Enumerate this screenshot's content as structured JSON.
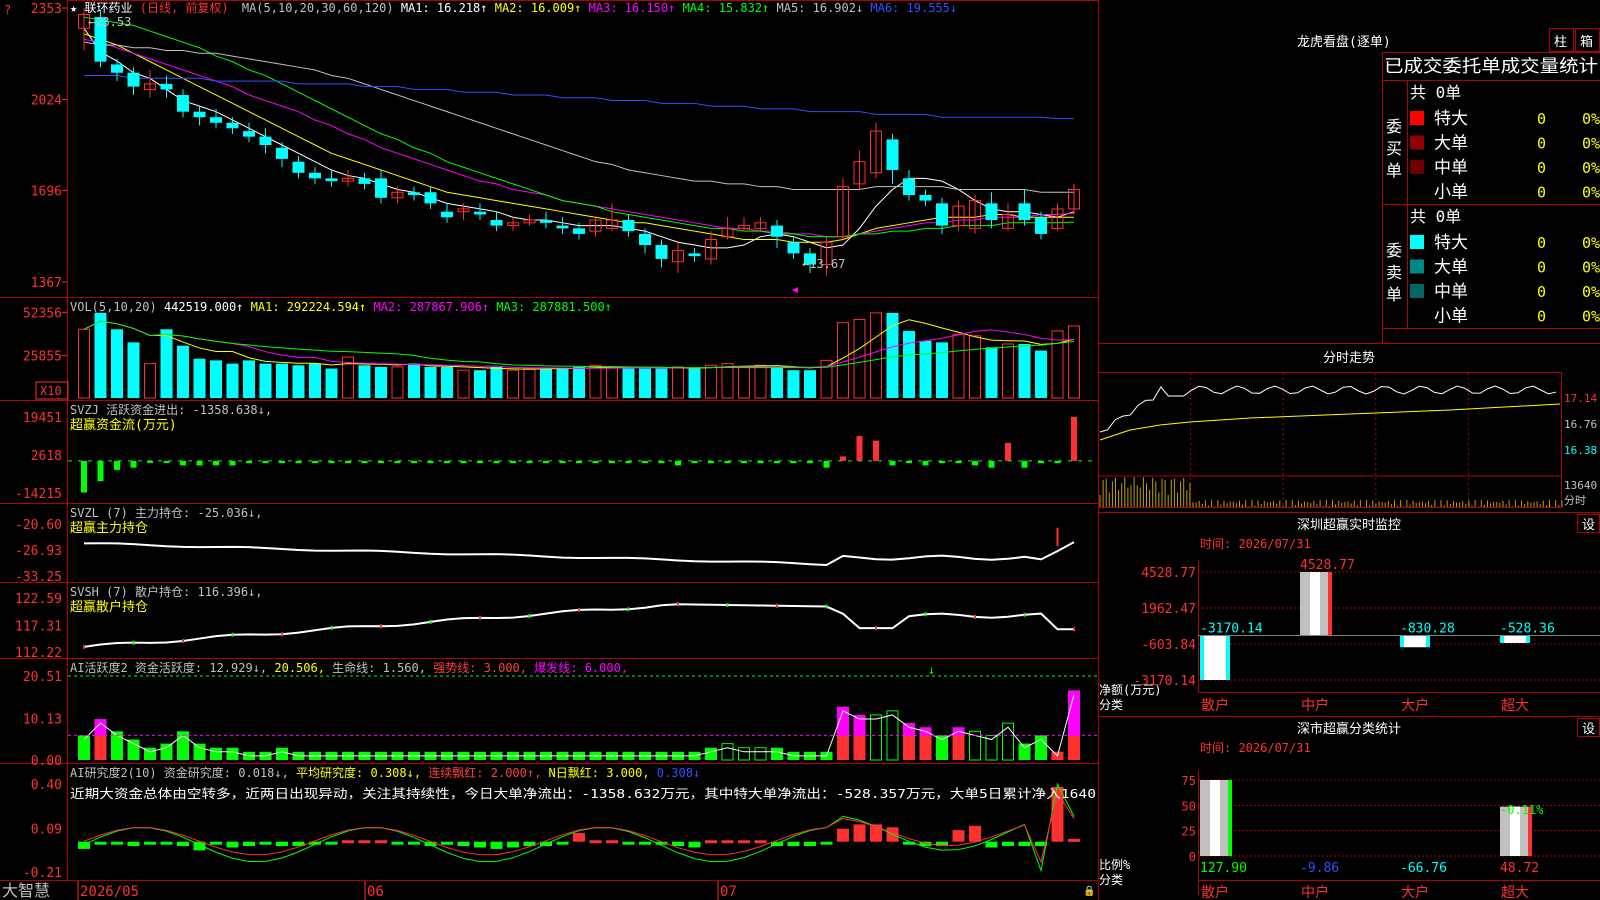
{
  "app": {
    "brand": "大智慧"
  },
  "stock": {
    "name": "联环药业",
    "period": "(日线, 前复权)"
  },
  "colors": {
    "up": "#ff3030",
    "down": "#00ffff",
    "bg": "#000000",
    "grid": "#b00000",
    "ma1": "#ffffff",
    "ma2": "#ffff00",
    "ma3": "#ff00ff",
    "ma4": "#00ff00",
    "ma5": "#c0c0c0",
    "ma6": "#3050ff"
  },
  "price_panel": {
    "header_prefix": "MA(5,10,20,30,60,120)",
    "ma_labels": [
      {
        "text": "MA1: 16.218",
        "arrow": "↑"
      },
      {
        "text": "MA2: 16.009",
        "arrow": "↑"
      },
      {
        "text": "MA3: 16.150",
        "arrow": "↑"
      },
      {
        "text": "MA4: 15.832",
        "arrow": "↑"
      },
      {
        "text": "MA5: 16.902",
        "arrow": "↓"
      },
      {
        "text": "MA6: 19.555",
        "arrow": "↓"
      }
    ],
    "ticks": [
      "2353",
      "2024",
      "1696",
      "1367"
    ],
    "high_label": "23.53",
    "low_label": "13.67"
  },
  "vol_panel": {
    "header": "VOL(5,10,20)",
    "items": [
      {
        "text": "442519.000",
        "arrow": "↑"
      },
      {
        "text": "MA1: 292224.594",
        "arrow": "↑"
      },
      {
        "text": "MA2: 287867.906",
        "arrow": "↑"
      },
      {
        "text": "MA3: 287881.500",
        "arrow": "↑"
      }
    ],
    "ticks": [
      "52356",
      "25855"
    ],
    "scale": "X10"
  },
  "svzj_panel": {
    "line1": "SVZJ  活跃资金进出: -1358.638↓,",
    "line2": "超赢资金流(万元)",
    "ticks": [
      "19451",
      "2618",
      "-14215"
    ]
  },
  "svzl_panel": {
    "line1": "SVZL  (7) 主力持仓: -25.036↓,",
    "line2": "超赢主力持仓",
    "ticks": [
      "-20.60",
      "-26.93",
      "-33.25"
    ]
  },
  "svsh_panel": {
    "line1": "SVSH  (7) 散户持仓: 116.396↓,",
    "line2": "超赢散户持仓",
    "ticks": [
      "122.59",
      "117.31",
      "112.22"
    ]
  },
  "ai_active_panel": {
    "parts": [
      {
        "text": "AI活跃度2 资金活跃度: 12.929↓,",
        "color": "#c0c0c0"
      },
      {
        "text": " 20.506,",
        "color": "#ffff00"
      },
      {
        "text": " 生命线: 1.560,",
        "color": "#c0c0c0"
      },
      {
        "text": " 强势线: 3.000,",
        "color": "#ff4040"
      },
      {
        "text": " 爆发线: 6.000,",
        "color": "#ff00ff"
      }
    ],
    "ticks": [
      "20.51",
      "10.13",
      "0.00"
    ]
  },
  "ai_research_panel": {
    "parts": [
      {
        "text": "AI研究度2(10) 资金研究度: 0.018↓,",
        "color": "#c0c0c0"
      },
      {
        "text": " 平均研究度: 0.308↓,",
        "color": "#ffff00"
      },
      {
        "text": " 连续飘红: 2.000↑,",
        "color": "#ff4040"
      },
      {
        "text": " N日飘红: 3.000,",
        "color": "#ffff00"
      },
      {
        "text": " 0.308↓",
        "color": "#3050ff"
      }
    ],
    "comment": "近期大资金总体由空转多，近两日出现异动，关注其持续性，今日大单净流出：-1358.632万元，其中特大单净流出：-528.357万元，大单5日累计净入1640",
    "ticks": [
      "0.40",
      "0.09",
      "-0.21"
    ]
  },
  "x_axis": {
    "labels": [
      "2026/05",
      "06",
      "07"
    ]
  },
  "longhu": {
    "title": "龙虎看盘(逐单)",
    "tabs": [
      "柱",
      "箱"
    ],
    "table_title": "已成交委托单成交量统计",
    "buy": {
      "label_chars": [
        "委",
        "买",
        "单"
      ],
      "total": "共 0单",
      "rows": [
        {
          "name": "特大",
          "count": "0",
          "pct": "0%"
        },
        {
          "name": "大单",
          "count": "0",
          "pct": "0%"
        },
        {
          "name": "中单",
          "count": "0",
          "pct": "0%"
        },
        {
          "name": "小单",
          "count": "0",
          "pct": "0%"
        }
      ]
    },
    "sell": {
      "label_chars": [
        "委",
        "卖",
        "单"
      ],
      "total": "共 0单",
      "rows": [
        {
          "name": "特大",
          "count": "0",
          "pct": "0%"
        },
        {
          "name": "大单",
          "count": "0",
          "pct": "0%"
        },
        {
          "name": "中单",
          "count": "0",
          "pct": "0%"
        },
        {
          "name": "小单",
          "count": "0",
          "pct": "0%"
        }
      ]
    }
  },
  "fenshi": {
    "title": "分时走势",
    "ticks": [
      "17.14",
      "16.76",
      "16.38"
    ],
    "vol_tick": "13640",
    "unit": "分时"
  },
  "monitor": {
    "title": "深圳超赢实时监控",
    "setting": "设",
    "time": "时间: 2026/07/31",
    "y_ticks": [
      "4528.77",
      "1962.47",
      "-603.84",
      "-3170.14"
    ],
    "ylabel1": "净额(万元)",
    "ylabel2": "分类",
    "categories": [
      "散户",
      "中户",
      "大户",
      "超大"
    ]
  },
  "classify": {
    "title": "深市超赢分类统计",
    "setting": "设",
    "time": "时间: 2026/07/31",
    "y_ticks": [
      "75",
      "50",
      "25",
      "0"
    ],
    "ylabel1": "比例%",
    "ylabel2": "分类",
    "categories": [
      "散户",
      "中户",
      "大户",
      "超大"
    ],
    "bottom_values": [
      "127.90",
      "-9.86",
      "-66.76",
      "48.72"
    ],
    "top_label": "-0.11%"
  },
  "chart_data": [
    {
      "type": "bar",
      "title": "深圳超赢实时监控",
      "categories": [
        "散户",
        "中户",
        "大户",
        "超大"
      ],
      "values": [
        -3170.14,
        4528.77,
        -830.28,
        -528.36
      ],
      "ylabel": "净额(万元)",
      "ylim": [
        -3170.14,
        4528.77
      ]
    },
    {
      "type": "bar",
      "title": "深市超赢分类统计",
      "categories": [
        "散户",
        "中户",
        "大户",
        "超大"
      ],
      "values": [
        127.9,
        -9.86,
        -66.76,
        48.72
      ],
      "ylabel": "比例%",
      "ylim": [
        0,
        75
      ]
    },
    {
      "type": "candlestick",
      "x": [
        "2026/05",
        "06",
        "07"
      ],
      "ylim": [
        13.67,
        23.53
      ],
      "candles": [
        [
          22.8,
          23.3,
          23.53,
          22.0
        ],
        [
          23.2,
          21.6,
          23.45,
          21.4
        ],
        [
          21.5,
          21.2,
          21.7,
          20.9
        ],
        [
          21.2,
          20.7,
          21.4,
          20.4
        ],
        [
          20.6,
          20.8,
          21.3,
          20.3
        ],
        [
          20.8,
          20.6,
          21.1,
          20.3
        ],
        [
          20.4,
          19.8,
          20.6,
          19.6
        ],
        [
          19.8,
          19.6,
          20.0,
          19.3
        ],
        [
          19.6,
          19.4,
          19.9,
          19.2
        ],
        [
          19.4,
          19.2,
          19.6,
          19.0
        ],
        [
          19.1,
          18.9,
          19.4,
          18.7
        ],
        [
          18.9,
          18.6,
          19.2,
          18.3
        ],
        [
          18.5,
          18.1,
          18.7,
          17.8
        ],
        [
          18.0,
          17.6,
          18.2,
          17.4
        ],
        [
          17.6,
          17.4,
          17.8,
          17.2
        ],
        [
          17.4,
          17.3,
          17.7,
          17.1
        ],
        [
          17.3,
          17.4,
          17.7,
          17.1
        ],
        [
          17.4,
          17.2,
          17.6,
          17.0
        ],
        [
          17.4,
          16.7,
          17.7,
          16.5
        ],
        [
          16.7,
          16.9,
          17.1,
          16.5
        ],
        [
          16.9,
          16.8,
          17.1,
          16.6
        ],
        [
          16.9,
          16.5,
          17.1,
          16.3
        ],
        [
          16.2,
          16.0,
          16.5,
          15.8
        ],
        [
          16.2,
          16.3,
          16.5,
          15.9
        ],
        [
          16.2,
          16.1,
          16.5,
          15.9
        ],
        [
          15.9,
          15.7,
          16.2,
          15.5
        ],
        [
          15.7,
          15.8,
          16.0,
          15.5
        ],
        [
          15.8,
          15.9,
          16.1,
          15.7
        ],
        [
          15.9,
          15.8,
          16.2,
          15.6
        ],
        [
          15.7,
          15.6,
          16.0,
          15.4
        ],
        [
          15.6,
          15.4,
          15.8,
          15.2
        ],
        [
          15.5,
          15.9,
          16.0,
          15.3
        ],
        [
          15.6,
          15.9,
          16.5,
          15.5
        ],
        [
          15.9,
          15.5,
          16.1,
          15.3
        ],
        [
          15.4,
          15.0,
          15.6,
          14.7
        ],
        [
          15.0,
          14.5,
          15.2,
          14.2
        ],
        [
          14.4,
          14.8,
          15.1,
          14.0
        ],
        [
          14.7,
          14.6,
          14.9,
          14.4
        ],
        [
          14.5,
          15.2,
          15.5,
          14.3
        ],
        [
          15.3,
          15.6,
          16.0,
          15.2
        ],
        [
          15.6,
          15.7,
          16.0,
          15.5
        ],
        [
          15.6,
          15.8,
          16.0,
          15.5
        ],
        [
          15.7,
          15.3,
          15.9,
          14.9
        ],
        [
          15.1,
          14.7,
          15.3,
          14.5
        ],
        [
          14.7,
          14.3,
          14.9,
          14.0
        ],
        [
          14.3,
          15.1,
          15.3,
          13.9
        ],
        [
          15.3,
          17.1,
          17.4,
          15.2
        ],
        [
          17.2,
          18.0,
          18.4,
          17.0
        ],
        [
          17.6,
          19.1,
          19.4,
          17.4
        ],
        [
          18.8,
          17.7,
          19.0,
          17.2
        ],
        [
          17.4,
          16.8,
          17.7,
          16.6
        ],
        [
          16.8,
          16.6,
          17.0,
          16.4
        ],
        [
          16.5,
          15.7,
          16.7,
          15.4
        ],
        [
          15.7,
          16.4,
          16.6,
          15.5
        ],
        [
          15.6,
          16.6,
          16.8,
          15.4
        ],
        [
          16.5,
          15.9,
          16.9,
          15.6
        ],
        [
          15.6,
          16.1,
          16.5,
          15.5
        ],
        [
          16.5,
          15.9,
          17.0,
          15.7
        ],
        [
          16.0,
          15.4,
          16.2,
          15.2
        ],
        [
          15.6,
          16.3,
          16.5,
          15.5
        ],
        [
          16.3,
          17.0,
          17.2,
          16.1
        ]
      ],
      "volume": [
        42,
        52,
        42,
        34,
        21,
        42,
        32,
        24,
        23,
        21,
        23,
        21,
        21,
        20,
        21,
        18,
        25,
        20,
        19,
        19,
        21,
        19,
        19,
        17,
        17,
        19,
        17,
        18,
        18,
        18,
        19,
        20,
        19,
        18,
        18,
        18,
        19,
        18,
        20,
        21,
        19,
        20,
        19,
        17,
        17,
        23,
        46,
        48,
        52,
        52,
        41,
        35,
        34,
        39,
        38,
        31,
        33,
        33,
        29,
        41,
        44
      ],
      "ma_series": [
        {
          "name": "MA1",
          "values": [
            22.8,
            21.95,
            21.62,
            21.2,
            21.0,
            20.6,
            20.2,
            20.0,
            19.8,
            19.5,
            19.2,
            18.9,
            18.6,
            18.3,
            18.0,
            17.7,
            17.5,
            17.4,
            17.2,
            17.0,
            16.9,
            16.7,
            16.5,
            16.4,
            16.3,
            16.2,
            16.0,
            15.9,
            15.9,
            15.8,
            15.7,
            15.7,
            15.7,
            15.6,
            15.5,
            15.3,
            15.1,
            15.0,
            14.9,
            14.9,
            15.0,
            15.3,
            15.4,
            15.3,
            15.1,
            14.9,
            15.0,
            15.6,
            16.4,
            17.0,
            17.4,
            17.4,
            17.3,
            17.0,
            16.6,
            16.3,
            16.2,
            16.2,
            16.1,
            16.0,
            16.2
          ]
        },
        {
          "name": "MA2",
          "values": [
            22.6,
            22.4,
            22.2,
            21.9,
            21.6,
            21.3,
            21.0,
            20.7,
            20.4,
            20.1,
            19.8,
            19.5,
            19.2,
            18.9,
            18.6,
            18.3,
            18.1,
            17.9,
            17.7,
            17.5,
            17.3,
            17.1,
            16.9,
            16.8,
            16.7,
            16.6,
            16.5,
            16.4,
            16.3,
            16.2,
            16.1,
            16.0,
            15.9,
            15.8,
            15.8,
            15.7,
            15.6,
            15.5,
            15.4,
            15.3,
            15.2,
            15.2,
            15.2,
            15.1,
            15.1,
            15.1,
            15.2,
            15.4,
            15.6,
            15.7,
            15.8,
            15.9,
            16.0,
            16.0,
            16.0,
            16.1,
            16.1,
            16.0,
            16.0,
            16.0,
            16.0
          ]
        },
        {
          "name": "MA3",
          "values": [
            22.4,
            22.3,
            22.1,
            21.9,
            21.7,
            21.5,
            21.3,
            21.1,
            20.9,
            20.7,
            20.4,
            20.2,
            20.0,
            19.8,
            19.5,
            19.3,
            19.0,
            18.8,
            18.5,
            18.3,
            18.1,
            17.9,
            17.7,
            17.5,
            17.3,
            17.2,
            17.0,
            16.9,
            16.8,
            16.6,
            16.5,
            16.4,
            16.3,
            16.2,
            16.1,
            16.0,
            15.9,
            15.8,
            15.7,
            15.6,
            15.6,
            15.5,
            15.5,
            15.4,
            15.4,
            15.3,
            15.3,
            15.4,
            15.5,
            15.6,
            15.7,
            15.8,
            15.8,
            15.9,
            15.9,
            16.0,
            16.0,
            16.0,
            16.1,
            16.1,
            16.15
          ]
        },
        {
          "name": "MA4",
          "values": [
            23.2,
            23.1,
            23.0,
            22.9,
            22.7,
            22.5,
            22.3,
            22.1,
            21.8,
            21.6,
            21.3,
            21.1,
            20.8,
            20.5,
            20.2,
            19.9,
            19.6,
            19.3,
            19.0,
            18.8,
            18.5,
            18.3,
            18.0,
            17.8,
            17.6,
            17.4,
            17.2,
            17.0,
            16.8,
            16.6,
            16.5,
            16.4,
            16.2,
            16.1,
            16.0,
            15.9,
            15.8,
            15.7,
            15.6,
            15.6,
            15.5,
            15.5,
            15.4,
            15.4,
            15.3,
            15.3,
            15.3,
            15.4,
            15.4,
            15.5,
            15.5,
            15.6,
            15.6,
            15.7,
            15.7,
            15.7,
            15.8,
            15.8,
            15.8,
            15.8,
            15.83
          ]
        },
        {
          "name": "MA5",
          "values": [
            22.3,
            22.2,
            22.2,
            22.1,
            22.1,
            22.0,
            22.0,
            21.9,
            21.9,
            21.8,
            21.7,
            21.6,
            21.5,
            21.4,
            21.3,
            21.1,
            21.0,
            20.8,
            20.6,
            20.4,
            20.2,
            20.0,
            19.8,
            19.6,
            19.4,
            19.2,
            19.0,
            18.8,
            18.6,
            18.4,
            18.2,
            18.0,
            17.9,
            17.7,
            17.6,
            17.5,
            17.4,
            17.3,
            17.3,
            17.2,
            17.2,
            17.1,
            17.1,
            17.0,
            17.0,
            17.0,
            17.0,
            17.0,
            17.1,
            17.1,
            17.1,
            17.1,
            17.1,
            17.0,
            17.0,
            17.0,
            17.0,
            17.0,
            16.9,
            16.9,
            16.9
          ]
        },
        {
          "name": "MA6",
          "values": [
            21.1,
            21.1,
            21.1,
            21.0,
            21.0,
            21.0,
            21.0,
            21.0,
            20.9,
            20.9,
            20.9,
            20.9,
            20.9,
            20.8,
            20.8,
            20.8,
            20.8,
            20.7,
            20.7,
            20.7,
            20.6,
            20.6,
            20.6,
            20.5,
            20.5,
            20.5,
            20.4,
            20.4,
            20.4,
            20.3,
            20.3,
            20.3,
            20.2,
            20.2,
            20.2,
            20.1,
            20.1,
            20.1,
            20.0,
            20.0,
            20.0,
            19.9,
            19.9,
            19.9,
            19.8,
            19.8,
            19.8,
            19.8,
            19.7,
            19.7,
            19.7,
            19.7,
            19.6,
            19.6,
            19.6,
            19.6,
            19.6,
            19.6,
            19.6,
            19.55,
            19.55
          ]
        }
      ]
    }
  ]
}
